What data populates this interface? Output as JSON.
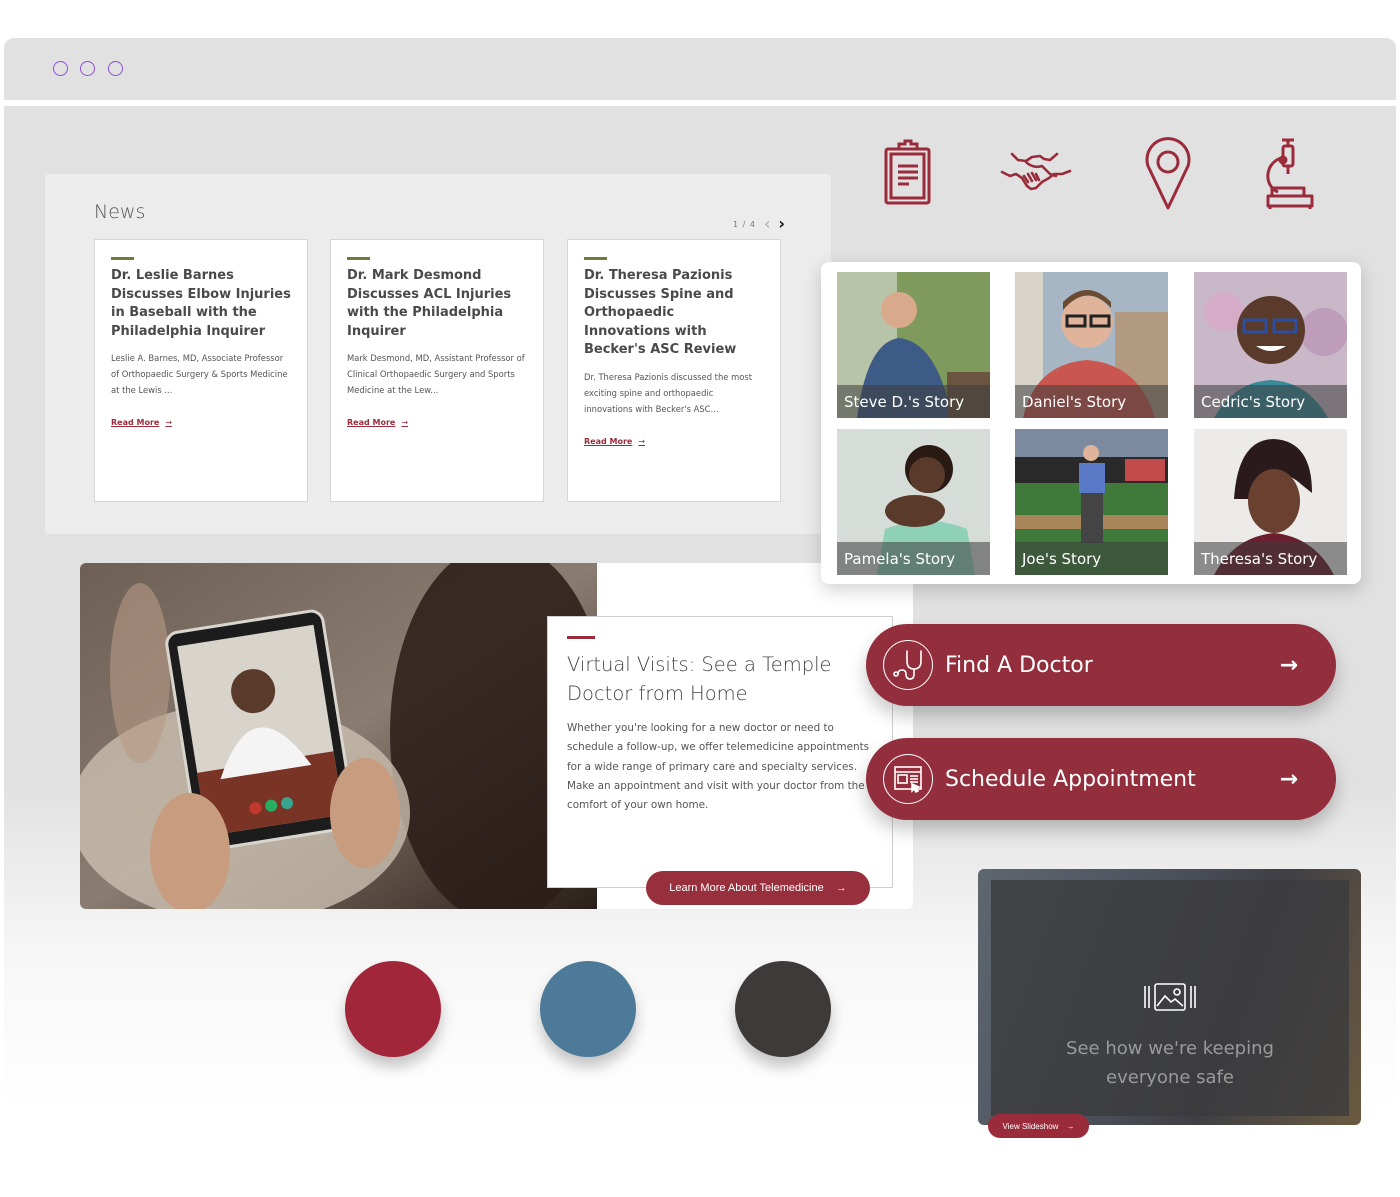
{
  "browser": {
    "window_controls": [
      "circle",
      "circle",
      "circle"
    ],
    "control_color": "#8a4fd8"
  },
  "top_icons": [
    {
      "name": "clipboard-icon"
    },
    {
      "name": "handshake-icon"
    },
    {
      "name": "location-pin-icon"
    },
    {
      "name": "microscope-icon"
    }
  ],
  "news": {
    "title": "News",
    "pager": {
      "count": "1 / 4",
      "prev": "‹",
      "next": "›"
    },
    "cards": [
      {
        "title": "Dr. Leslie Barnes Discusses Elbow Injuries in Baseball with the Philadelphia Inquirer",
        "text": "Leslie A. Barnes, MD, Associate Professor of Orthopaedic Surgery & Sports Medicine at the Lewis ...",
        "link": "Read More",
        "arrow": "→"
      },
      {
        "title": "Dr. Mark Desmond Discusses ACL Injuries with the Philadelphia Inquirer",
        "text": "Mark Desmond, MD, Assistant Professor of Clinical Orthopaedic Surgery and Sports Medicine at the Lew...",
        "link": "Read More",
        "arrow": "→"
      },
      {
        "title": "Dr. Theresa Pazionis Discusses Spine and Orthopaedic Innovations with Becker's ASC Review",
        "text": "Dr. Theresa Pazionis discussed the most exciting spine and orthopaedic innovations with Becker's ASC...",
        "link": "Read More",
        "arrow": "→"
      }
    ]
  },
  "stories": [
    {
      "label": "Steve D.'s Story"
    },
    {
      "label": "Daniel's Story"
    },
    {
      "label": "Cedric's Story"
    },
    {
      "label": "Pamela's Story"
    },
    {
      "label": "Joe's Story"
    },
    {
      "label": "Theresa's Story"
    }
  ],
  "virtual_visits": {
    "title": "Virtual Visits: See a Temple Doctor from Home",
    "text": "Whether you're looking for a new doctor or need to schedule a follow-up, we offer telemedicine appointments for a wide range of primary care and specialty services. Make an appointment and visit with your doctor from the comfort of your own home.",
    "button": "Learn More About Telemedicine",
    "button_arrow": "→"
  },
  "actions": [
    {
      "label": "Find A Doctor",
      "icon": "stethoscope-icon",
      "arrow": "→"
    },
    {
      "label": "Schedule Appointment",
      "icon": "web-appointment-icon",
      "arrow": "→"
    }
  ],
  "palette": {
    "swatches": [
      "#a2263a",
      "#4d7a98",
      "#3d3a39"
    ],
    "accent": "#932e3d",
    "news_rule": "#6f7d3a"
  },
  "safety": {
    "icon": "gallery-icon",
    "text": "See how we're keeping everyone safe",
    "button": "View Slideshow",
    "button_arrow": "→"
  }
}
